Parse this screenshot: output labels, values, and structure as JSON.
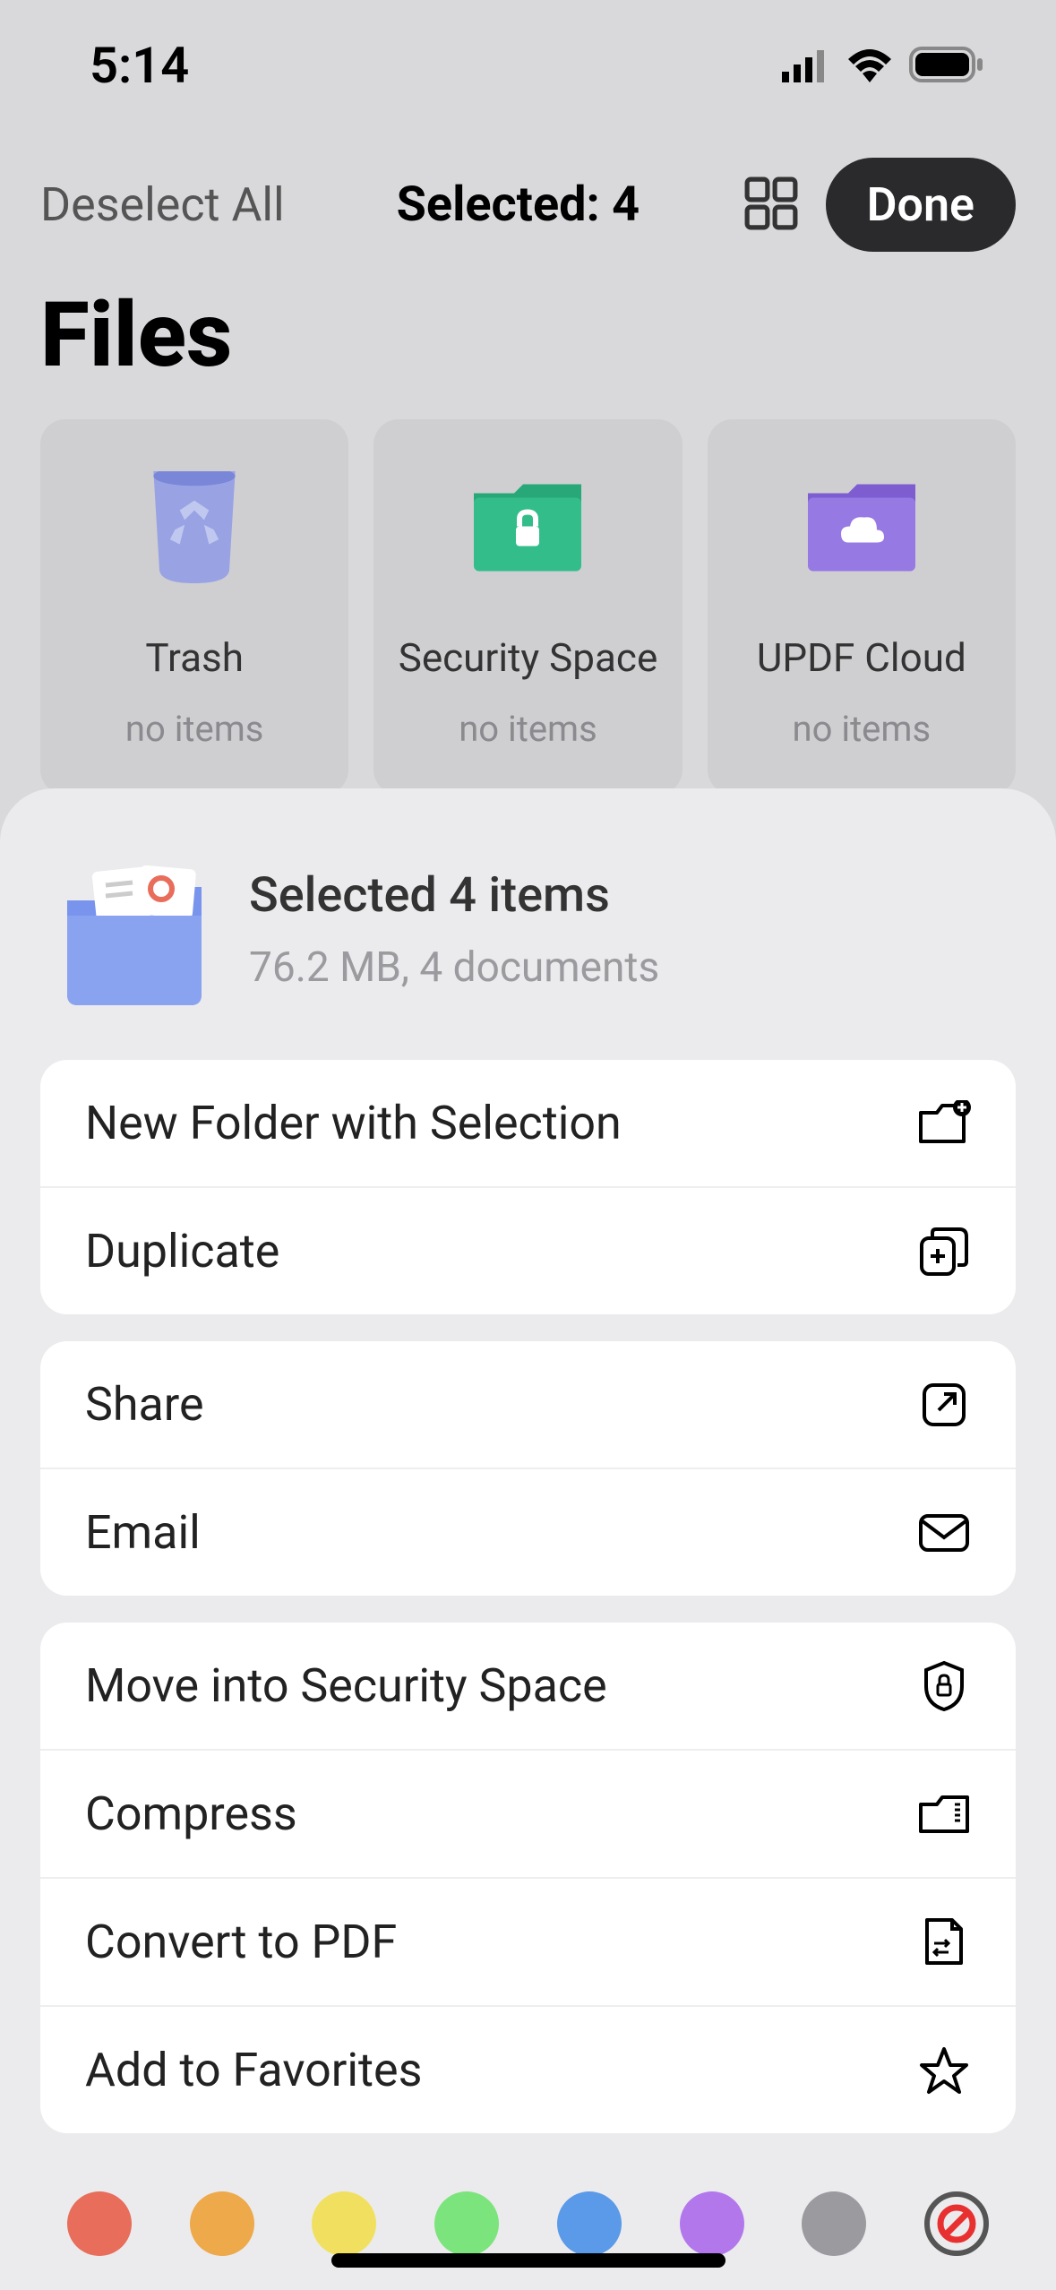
{
  "status": {
    "time": "5:14"
  },
  "toolbar": {
    "deselect_label": "Deselect All",
    "selected_label": "Selected: 4",
    "done_label": "Done"
  },
  "page_title": "Files",
  "folders": [
    {
      "name": "Trash",
      "meta": "no items",
      "icon": "trash",
      "color": "#8f9de8"
    },
    {
      "name": "Security Space",
      "meta": "no items",
      "icon": "lock-folder",
      "color": "#2fb087"
    },
    {
      "name": "UPDF Cloud",
      "meta": "no items",
      "icon": "cloud-folder",
      "color": "#8d6de0"
    }
  ],
  "sheet": {
    "title": "Selected 4 items",
    "subtitle": "76.2 MB, 4 documents"
  },
  "actions": {
    "group1": [
      {
        "label": "New Folder with Selection",
        "icon": "new-folder-icon"
      },
      {
        "label": "Duplicate",
        "icon": "duplicate-icon"
      }
    ],
    "group2": [
      {
        "label": "Share",
        "icon": "share-icon"
      },
      {
        "label": "Email",
        "icon": "email-icon"
      }
    ],
    "group3": [
      {
        "label": "Move into Security Space",
        "icon": "shield-lock-icon"
      },
      {
        "label": "Compress",
        "icon": "compress-icon"
      },
      {
        "label": "Convert to PDF",
        "icon": "convert-pdf-icon"
      },
      {
        "label": "Add to Favorites",
        "icon": "star-icon"
      }
    ]
  },
  "colors": [
    "#e86d5a",
    "#eda94a",
    "#f1e05f",
    "#7ce47c",
    "#5a9ae8",
    "#b377ec",
    "#9a9a9f"
  ]
}
